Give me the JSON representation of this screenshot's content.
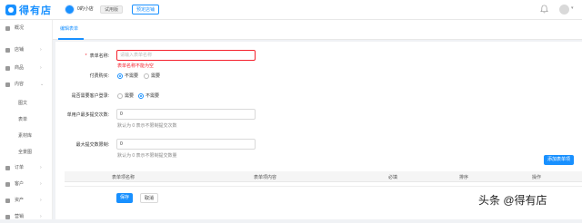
{
  "header": {
    "logo_text": "得有店",
    "shop_name": "0的小店",
    "trial_tag": "试用版",
    "upgrade_button": "预定店铺",
    "user_caret": "▾"
  },
  "sidebar": {
    "items": [
      {
        "label": "概况"
      },
      {
        "label": "店铺"
      },
      {
        "label": "商品"
      },
      {
        "label": "内容"
      },
      {
        "label": "订单"
      },
      {
        "label": "客户"
      },
      {
        "label": "资产"
      },
      {
        "label": "营销"
      }
    ],
    "content_sub": [
      "图文",
      "表单",
      "素材库",
      "全景图"
    ]
  },
  "tabs": {
    "active": "编辑表单"
  },
  "form": {
    "name_label": "表单名称:",
    "name_placeholder": "请输入表单名称",
    "name_error": "表单名称不能为空",
    "pay_label": "付费购买:",
    "pay_options": [
      "不需要",
      "需要"
    ],
    "login_label": "是否需要客户登录:",
    "login_options": [
      "需要",
      "不需要"
    ],
    "per_user_label": "单用户最多提交次数:",
    "per_user_value": "0",
    "per_user_help": "默认为 0 表示不限制提交次数",
    "max_label": "最大提交数限制:",
    "max_value": "0",
    "max_help": "默认为 0 表示不限制提交数量",
    "add_item_button": "添加表单项"
  },
  "table": {
    "headers": [
      "表单项名称",
      "表单项内容",
      "必填",
      "排序",
      "操作"
    ]
  },
  "actions": {
    "save": "保存",
    "cancel": "取消"
  },
  "watermark": "头条 @得有店",
  "colors": {
    "primary": "#1890ff",
    "error": "#f5222d"
  }
}
